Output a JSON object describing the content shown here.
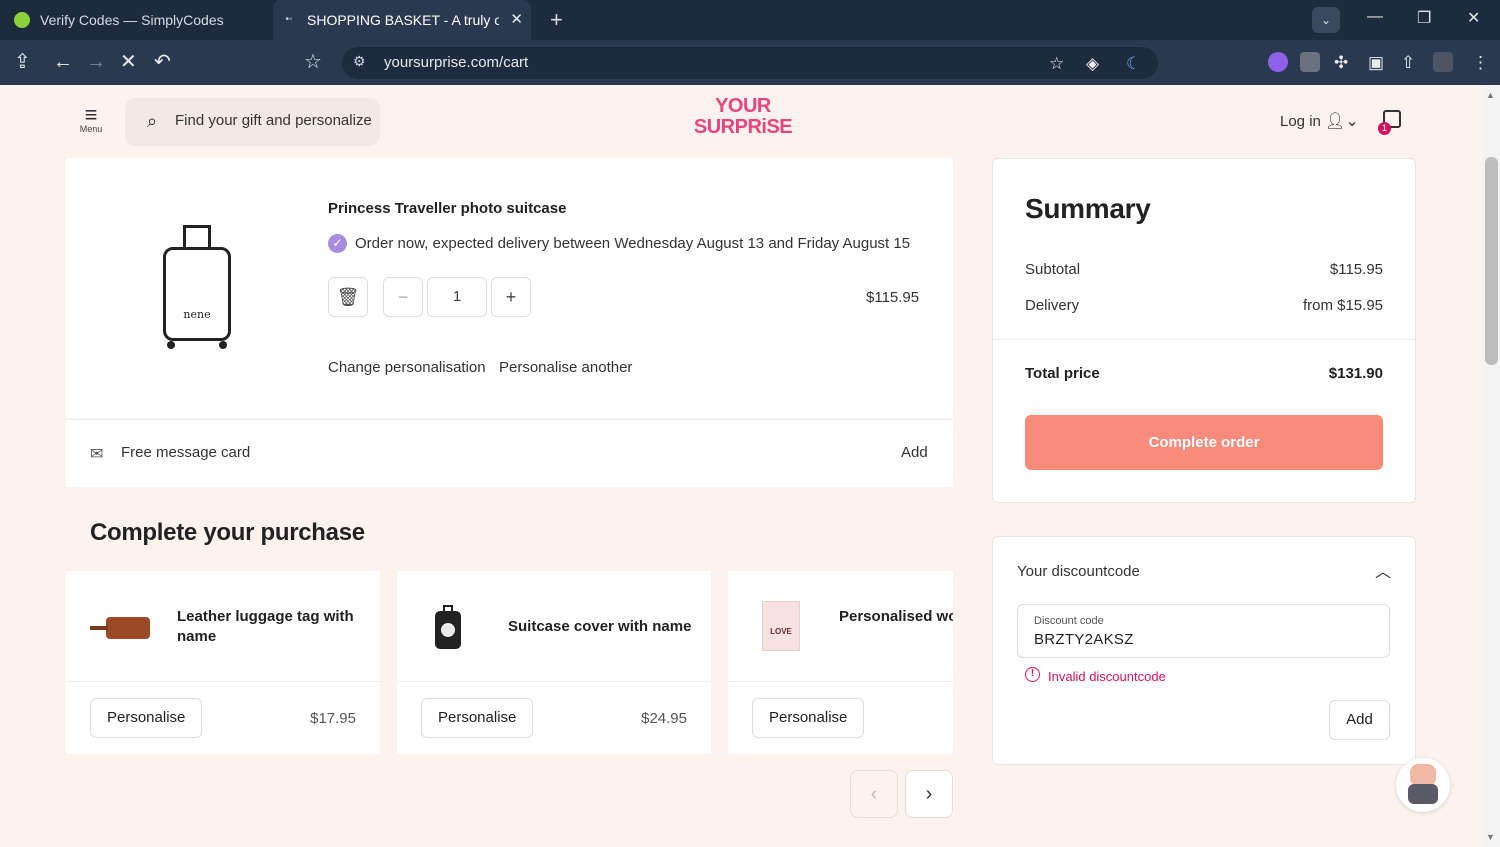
{
  "browser": {
    "tabs": [
      {
        "title": "Verify Codes — SimplyCodes",
        "active": false
      },
      {
        "title": "SHOPPING BASKET - A truly original",
        "active": true
      }
    ],
    "url": "yoursurprise.com/cart"
  },
  "header": {
    "menu_label": "Menu",
    "search_placeholder": "Find your gift and personalize",
    "logo_text": [
      "YOUR",
      "SURPRiSE"
    ],
    "login_label": "Log in",
    "cart_count": "1",
    "brand_color": "#e8457e"
  },
  "cart_item": {
    "title": "Princess Traveller photo suitcase",
    "delivery_text": "Order now, expected delivery between Wednesday August 13 and Friday August 15",
    "quantity": "1",
    "price": "$115.95",
    "suitcase_name": "nene",
    "change_personalisation": "Change personalisation",
    "personalise_another": "Personalise another"
  },
  "message_card": {
    "label": "Free message card",
    "action": "Add"
  },
  "recommendations": {
    "title": "Complete your purchase",
    "items": [
      {
        "name": "Leather luggage tag with name",
        "button": "Personalise",
        "price": "$17.95"
      },
      {
        "name": "Suitcase cover with name",
        "button": "Personalise",
        "price": "$24.95"
      },
      {
        "name": "Personalised wooden postcard - Love",
        "button": "Personalise",
        "price": ""
      }
    ]
  },
  "summary": {
    "title": "Summary",
    "subtotal_label": "Subtotal",
    "subtotal_value": "$115.95",
    "delivery_label": "Delivery",
    "delivery_value": "from $15.95",
    "total_label": "Total price",
    "total_value": "$131.90",
    "complete_button": "Complete order",
    "button_color": "#f98b7b"
  },
  "discount": {
    "title": "Your discountcode",
    "field_label": "Discount code",
    "field_value": "BRZTY2AKSZ",
    "error": "Invalid discountcode",
    "add_button": "Add",
    "error_color": "#d4145a"
  }
}
